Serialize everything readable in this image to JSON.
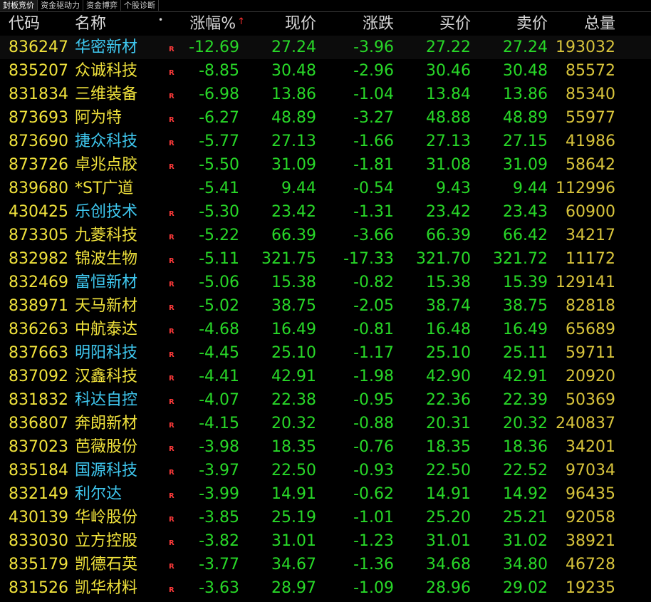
{
  "tabs": [
    "封板竞价",
    "资金驱动力",
    "资金博弈",
    "个股诊断"
  ],
  "header": {
    "code": "代码",
    "name": "名称",
    "pct": "涨幅%",
    "price": "现价",
    "change": "涨跌",
    "bid": "买价",
    "ask": "卖价",
    "volume": "总量",
    "sort_arrow": "↑",
    "dot": "•"
  },
  "colors": {
    "background": "#000000",
    "code": "#f0e23c",
    "name_yellow": "#f0e23c",
    "name_cyan": "#3fc8f0",
    "down_green": "#28d828",
    "volume": "#d8c43c",
    "r_mark": "#ff3a3a"
  },
  "rows": [
    {
      "code": "836247",
      "name": "华密新材",
      "cyan": true,
      "r": "R",
      "pct": "-12.69",
      "price": "27.24",
      "change": "-3.96",
      "bid": "27.22",
      "ask": "27.24",
      "volume": "193032"
    },
    {
      "code": "835207",
      "name": "众诚科技",
      "cyan": false,
      "r": "R",
      "pct": "-8.85",
      "price": "30.48",
      "change": "-2.96",
      "bid": "30.46",
      "ask": "30.48",
      "volume": "85572"
    },
    {
      "code": "831834",
      "name": "三维装备",
      "cyan": false,
      "r": "R",
      "pct": "-6.98",
      "price": "13.86",
      "change": "-1.04",
      "bid": "13.84",
      "ask": "13.86",
      "volume": "85340"
    },
    {
      "code": "873693",
      "name": "阿为特",
      "cyan": false,
      "r": "R",
      "pct": "-6.27",
      "price": "48.89",
      "change": "-3.27",
      "bid": "48.88",
      "ask": "48.89",
      "volume": "55977"
    },
    {
      "code": "873690",
      "name": "捷众科技",
      "cyan": true,
      "r": "R",
      "pct": "-5.77",
      "price": "27.13",
      "change": "-1.66",
      "bid": "27.13",
      "ask": "27.15",
      "volume": "41986"
    },
    {
      "code": "873726",
      "name": "卓兆点胶",
      "cyan": false,
      "r": "R",
      "pct": "-5.50",
      "price": "31.09",
      "change": "-1.81",
      "bid": "31.08",
      "ask": "31.09",
      "volume": "58642"
    },
    {
      "code": "839680",
      "name": "*ST广道",
      "cyan": false,
      "r": "",
      "pct": "-5.41",
      "price": "9.44",
      "change": "-0.54",
      "bid": "9.43",
      "ask": "9.44",
      "volume": "112996"
    },
    {
      "code": "430425",
      "name": "乐创技术",
      "cyan": true,
      "r": "R",
      "pct": "-5.30",
      "price": "23.42",
      "change": "-1.31",
      "bid": "23.42",
      "ask": "23.43",
      "volume": "60900"
    },
    {
      "code": "873305",
      "name": "九菱科技",
      "cyan": false,
      "r": "R",
      "pct": "-5.22",
      "price": "66.39",
      "change": "-3.66",
      "bid": "66.39",
      "ask": "66.42",
      "volume": "34217"
    },
    {
      "code": "832982",
      "name": "锦波生物",
      "cyan": false,
      "r": "R",
      "pct": "-5.11",
      "price": "321.75",
      "change": "-17.33",
      "bid": "321.70",
      "ask": "321.72",
      "volume": "11172"
    },
    {
      "code": "832469",
      "name": "富恒新材",
      "cyan": true,
      "r": "R",
      "pct": "-5.06",
      "price": "15.38",
      "change": "-0.82",
      "bid": "15.38",
      "ask": "15.39",
      "volume": "129141"
    },
    {
      "code": "838971",
      "name": "天马新材",
      "cyan": false,
      "r": "R",
      "pct": "-5.02",
      "price": "38.75",
      "change": "-2.05",
      "bid": "38.74",
      "ask": "38.75",
      "volume": "82818"
    },
    {
      "code": "836263",
      "name": "中航泰达",
      "cyan": false,
      "r": "R",
      "pct": "-4.68",
      "price": "16.49",
      "change": "-0.81",
      "bid": "16.48",
      "ask": "16.49",
      "volume": "65689"
    },
    {
      "code": "837663",
      "name": "明阳科技",
      "cyan": true,
      "r": "R",
      "pct": "-4.45",
      "price": "25.10",
      "change": "-1.17",
      "bid": "25.10",
      "ask": "25.11",
      "volume": "59711"
    },
    {
      "code": "837092",
      "name": "汉鑫科技",
      "cyan": false,
      "r": "R",
      "pct": "-4.41",
      "price": "42.91",
      "change": "-1.98",
      "bid": "42.90",
      "ask": "42.91",
      "volume": "20920"
    },
    {
      "code": "831832",
      "name": "科达自控",
      "cyan": true,
      "r": "R",
      "pct": "-4.07",
      "price": "22.38",
      "change": "-0.95",
      "bid": "22.36",
      "ask": "22.39",
      "volume": "50369"
    },
    {
      "code": "836807",
      "name": "奔朗新材",
      "cyan": false,
      "r": "R",
      "pct": "-4.15",
      "price": "20.32",
      "change": "-0.88",
      "bid": "20.31",
      "ask": "20.32",
      "volume": "240837"
    },
    {
      "code": "837023",
      "name": "芭薇股份",
      "cyan": false,
      "r": "R",
      "pct": "-3.98",
      "price": "18.35",
      "change": "-0.76",
      "bid": "18.35",
      "ask": "18.36",
      "volume": "34201"
    },
    {
      "code": "835184",
      "name": "国源科技",
      "cyan": true,
      "r": "R",
      "pct": "-3.97",
      "price": "22.50",
      "change": "-0.93",
      "bid": "22.50",
      "ask": "22.52",
      "volume": "97034"
    },
    {
      "code": "832149",
      "name": "利尔达",
      "cyan": true,
      "r": "R",
      "pct": "-3.99",
      "price": "14.91",
      "change": "-0.62",
      "bid": "14.91",
      "ask": "14.92",
      "volume": "96435"
    },
    {
      "code": "430139",
      "name": "华岭股份",
      "cyan": false,
      "r": "R",
      "pct": "-3.85",
      "price": "25.19",
      "change": "-1.01",
      "bid": "25.20",
      "ask": "25.21",
      "volume": "92058"
    },
    {
      "code": "833030",
      "name": "立方控股",
      "cyan": false,
      "r": "R",
      "pct": "-3.82",
      "price": "31.01",
      "change": "-1.23",
      "bid": "31.01",
      "ask": "31.02",
      "volume": "38921"
    },
    {
      "code": "835179",
      "name": "凯德石英",
      "cyan": false,
      "r": "R",
      "pct": "-3.77",
      "price": "34.67",
      "change": "-1.36",
      "bid": "34.68",
      "ask": "34.80",
      "volume": "46728"
    },
    {
      "code": "831526",
      "name": "凯华材料",
      "cyan": false,
      "r": "R",
      "pct": "-3.63",
      "price": "28.97",
      "change": "-1.09",
      "bid": "28.96",
      "ask": "29.02",
      "volume": "19235"
    }
  ]
}
